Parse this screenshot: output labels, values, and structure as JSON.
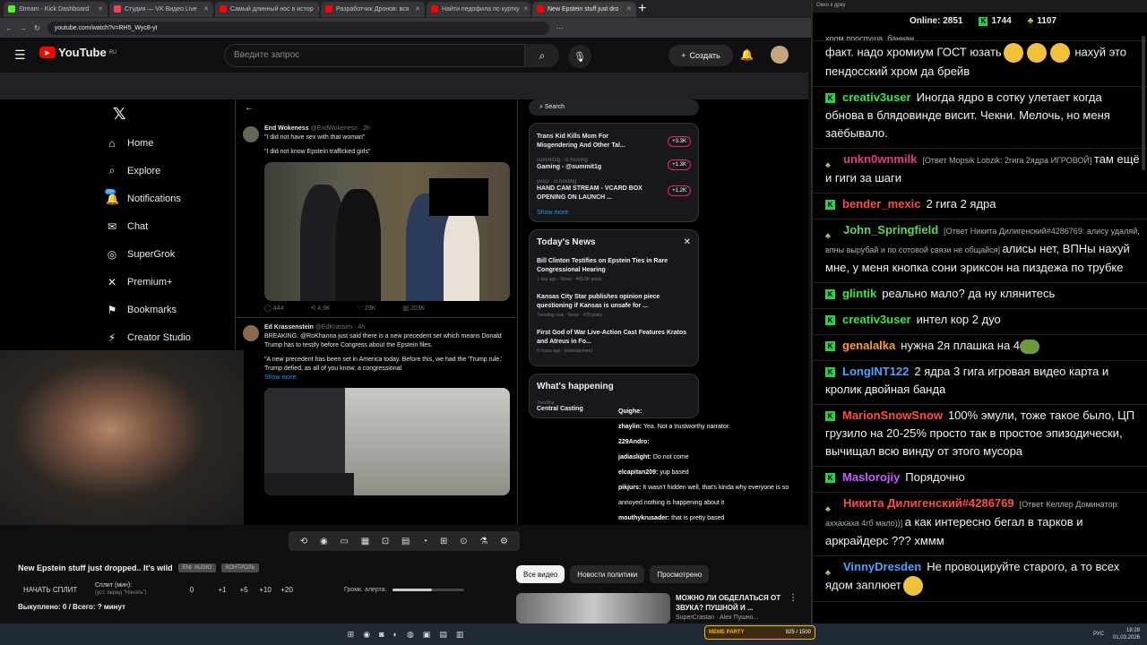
{
  "browser": {
    "tabs": [
      {
        "label": "Stream - Kick Dashboard",
        "color": "#53fc18"
      },
      {
        "label": "Студия — VK Видео Live",
        "color": "#ff3b5c"
      },
      {
        "label": "Самый длинный нос в истор",
        "color": "#ff0000"
      },
      {
        "label": "Разработчик Дронов: вся",
        "color": "#ff0000"
      },
      {
        "label": "Найти педофила по куртку",
        "color": "#ff0000"
      },
      {
        "label": "New Epstein stuff just dro",
        "color": "#ff0000"
      }
    ],
    "url": "youtube.com/watch?v=RH5_Wyc8-yI"
  },
  "youtube": {
    "logo": "YouTube",
    "logo_region": "RU",
    "search_placeholder": "Введите запрос",
    "create_label": "Создать",
    "video_title": "New Epstein stuff just dropped.. It's wild",
    "title_pills": [
      "ENI  AUDIO",
      "КОНТРОЛЬ"
    ],
    "split": {
      "start_label": "НАЧАТЬ СПЛИТ",
      "split_min_label": "Сплит (мин):",
      "split_min_sub": "(уст. перед \"Начать\")",
      "value": "0",
      "increments": [
        "+1",
        "+5",
        "+10",
        "+20"
      ],
      "alert_label": "Громк. алерта:",
      "alert_volume": 0.55
    },
    "bought": "Выкуплено: 0 / Всего: ? минут",
    "chips": [
      "Все видео",
      "Новости политики",
      "Просмотрено"
    ],
    "recommendation": {
      "title": "МОЖНО ЛИ ОБДЕЛАТЬСЯ ОТ ЗВУКА? ПУШНОЙ И ...",
      "channel": "SuperCrastan · Alex Пушно..."
    }
  },
  "x_page": {
    "nav": [
      {
        "label": "Home",
        "icon": "home-icon",
        "glyph": "⌂"
      },
      {
        "label": "Explore",
        "icon": "search-icon",
        "glyph": "⌕"
      },
      {
        "label": "Notifications",
        "icon": "bell-icon",
        "glyph": "🔔"
      },
      {
        "label": "Chat",
        "icon": "mail-icon",
        "glyph": "✉"
      },
      {
        "label": "SuperGrok",
        "icon": "grok-icon",
        "glyph": "◎"
      },
      {
        "label": "Premium+",
        "icon": "premium-icon",
        "glyph": "✕"
      },
      {
        "label": "Bookmarks",
        "icon": "bookmark-icon",
        "glyph": "⚑"
      },
      {
        "label": "Creator Studio",
        "icon": "creator-icon",
        "glyph": "⚡"
      }
    ],
    "notif_badge": "20+",
    "tweets": [
      {
        "name": "End Wokeness",
        "handle": "@EndWokeness · 2h",
        "text1": "\"I did not have sex with that woman\"",
        "text2": "\"I did not know Epstein trafficked girls\"",
        "stats": [
          "444",
          "4.9K",
          "29K",
          "203K"
        ]
      },
      {
        "name": "Ed Krassenstein",
        "handle": "@EdKrassen · 4h",
        "text1": "BREAKING: @RoKhanna just said there is a new precedent set which means Donald Trump has to testify before Congress about the Epstein files.",
        "text2": "\"A new precedent has been set in America today. Before this, we had the 'Trump rule.' Trump defied, as all of you know, a congressional",
        "more": "Show more"
      }
    ],
    "search_label": "Search",
    "live": [
      {
        "title": "Trans Kid Kills Mom For Misgendering And Other Tal...",
        "sub": "",
        "count": "+3.3K"
      },
      {
        "title": "Gaming - @summit1g",
        "sub": "summit1g · is hosting",
        "count": "+1.3K"
      },
      {
        "title": "HAND CAM STREAM - VCARD BOX OPENING ON LAUNCH ...",
        "sub": "yocci · is hosting",
        "count": "+1.2K"
      }
    ],
    "show_more": "Show more",
    "news_title": "Today's News",
    "news": [
      {
        "title": "Bill Clinton Testifies on Epstein Ties in Rare Congressional Hearing",
        "meta": "1 day ago · News · 443.5K posts"
      },
      {
        "title": "Kansas City Star publishes opinion piece questioning if Kansas is unsafe for ...",
        "meta": "Trending now · News · 479 posts"
      },
      {
        "title": "First God of War Live-Action Cast Features Kratos and Atreus in Fo...",
        "meta": "6 hours ago · Entertainment"
      }
    ],
    "happening": "What's happening",
    "trend_label": "Trending",
    "trend": "Central Casting"
  },
  "cam_chat": [
    {
      "user": "Quighe:",
      "text": ""
    },
    {
      "user": "zhaylin:",
      "text": "Yea. Not a trustworthy narrator."
    },
    {
      "user": "229Andro:",
      "text": ""
    },
    {
      "user": "jadiaslight:",
      "text": "Do not come"
    },
    {
      "user": "elcapitan209:",
      "text": "yup based"
    },
    {
      "user": "pikjurs:",
      "text": "It wasn't hidden well, that's kinda why everyone is so annoyed nothing is happening about it"
    },
    {
      "user": "mouthykrusader:",
      "text": "that is pretty based"
    }
  ],
  "chat_panel": {
    "header": "Окно к дрку",
    "online_label": "Online:",
    "online": "2851",
    "kick_count": "1744",
    "vk_count": "1107",
    "messages": [
      {
        "user": "",
        "user_color": "#ffffff",
        "badge": "",
        "reply": "",
        "text": "хром проспуша, баннан",
        "emotes": 0
      },
      {
        "user": "",
        "user_color": "#ffffff",
        "badge": "",
        "reply": "",
        "text": "факт. надо хромиум ГОСТ юзать",
        "emotes": 3,
        "after": "нахуй это пендосский хром да брейв"
      },
      {
        "user": "creativ3user",
        "user_color": "#2ee74f",
        "badge": "K",
        "reply": "",
        "text": "Иногда ядро в сотку улетает когда обнова в блядовинде висит. Чекни. Мелочь, но меня заёбывало."
      },
      {
        "user": "unkn0wnmilk",
        "user_color": "#e23b8c",
        "badge": "vk",
        "reply": "[Ответ Mopsik Lobzik: 2гига 2ядра ИГРОВОЙ]",
        "text": "там ещё и гиги за шаги"
      },
      {
        "user": "bender_mexic",
        "user_color": "#ff4a4a",
        "badge": "K",
        "reply": "",
        "text": "2 гига 2 ядра"
      },
      {
        "user": "John_Springfield",
        "user_color": "#5ed35e",
        "badge": "vk",
        "reply": "[Ответ Никита Дилигенский#4286769: алису удаляй, впны вырубай и по сотовой связи не общайся]",
        "text": "алисы нет, ВПНы нахуй мне, у меня кнопка сони эриксон на пиздежа по трубке"
      },
      {
        "user": "glintik",
        "user_color": "#2ee74f",
        "badge": "K",
        "reply": "",
        "text": "реально мало? да ну клянитесь"
      },
      {
        "user": "creativ3user",
        "user_color": "#2ee74f",
        "badge": "K",
        "reply": "",
        "text": "интел кор 2 дуо"
      },
      {
        "user": "genalalka",
        "user_color": "#ff9a2e",
        "badge": "K",
        "reply": "",
        "text": "нужна 2я плашка на 4"
      },
      {
        "user": "LongINT122",
        "user_color": "#4aa4ff",
        "badge": "K",
        "reply": "",
        "text": "2 ядра 3 гига игровая видео карта и кролик двойная банда"
      },
      {
        "user": "MarionSnowSnow",
        "user_color": "#ff4a4a",
        "badge": "K",
        "reply": "",
        "text": "100% эмули, тоже такое было, ЦП грузило на 20-25% просто так в простое эпизодически, вычищал всю винду от этого мусора"
      },
      {
        "user": "Maslorojiy",
        "user_color": "#c85cff",
        "badge": "K",
        "reply": "",
        "text": "Порядочно"
      },
      {
        "user": "Никита Дилигенский#4286769",
        "user_color": "#ff4a4a",
        "badge": "vk",
        "reply": "[Ответ Келлер Доминатор: аххахаха 4гб мало))]",
        "text": "а как интересно бегал в тарков и аркрайдерс ??? хммм"
      },
      {
        "user": "VinnyDresden",
        "user_color": "#4aa4ff",
        "badge": "vk",
        "reply": "",
        "text": "Не провоцируйте старого, а то всех ядом заплюет"
      }
    ]
  },
  "taskbar": {
    "meme": "МЕМЕ PARTY",
    "meme_count": "925 / 1500",
    "lang": "РУС",
    "time": "18:28",
    "date": "01.03.2026"
  }
}
